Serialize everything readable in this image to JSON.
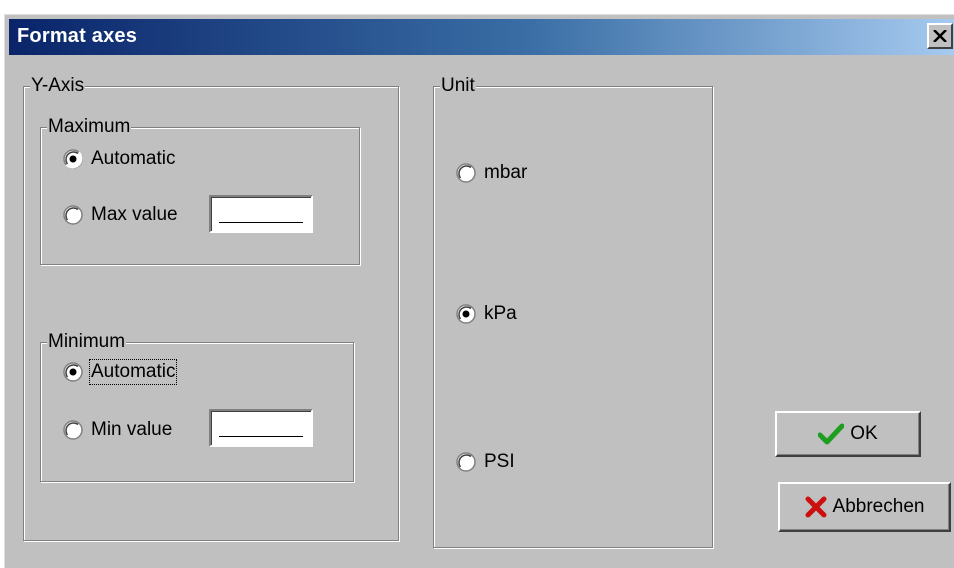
{
  "window": {
    "title": "Format axes",
    "close_icon": "close-icon"
  },
  "y_axis": {
    "title": "Y-Axis",
    "maximum": {
      "title": "Maximum",
      "options": [
        {
          "label": "Automatic",
          "checked": true
        },
        {
          "label": "Max value",
          "checked": false
        }
      ],
      "value": ""
    },
    "minimum": {
      "title": "Minimum",
      "options": [
        {
          "label": "Automatic",
          "checked": true,
          "focused": true
        },
        {
          "label": "Min value",
          "checked": false
        }
      ],
      "value": ""
    }
  },
  "unit": {
    "title": "Unit",
    "options": [
      {
        "label": "mbar",
        "checked": false
      },
      {
        "label": "kPa",
        "checked": true
      },
      {
        "label": "PSI",
        "checked": false
      }
    ]
  },
  "buttons": {
    "ok": {
      "label": "OK",
      "icon": "checkmark-icon",
      "icon_color": "#1e9e1e"
    },
    "cancel": {
      "label": "Abbrechen",
      "icon": "x-icon",
      "icon_color": "#cc1010"
    }
  },
  "colors": {
    "face": "#c0c0c0",
    "title_start": "#0a246a",
    "title_end": "#a6caf0"
  }
}
